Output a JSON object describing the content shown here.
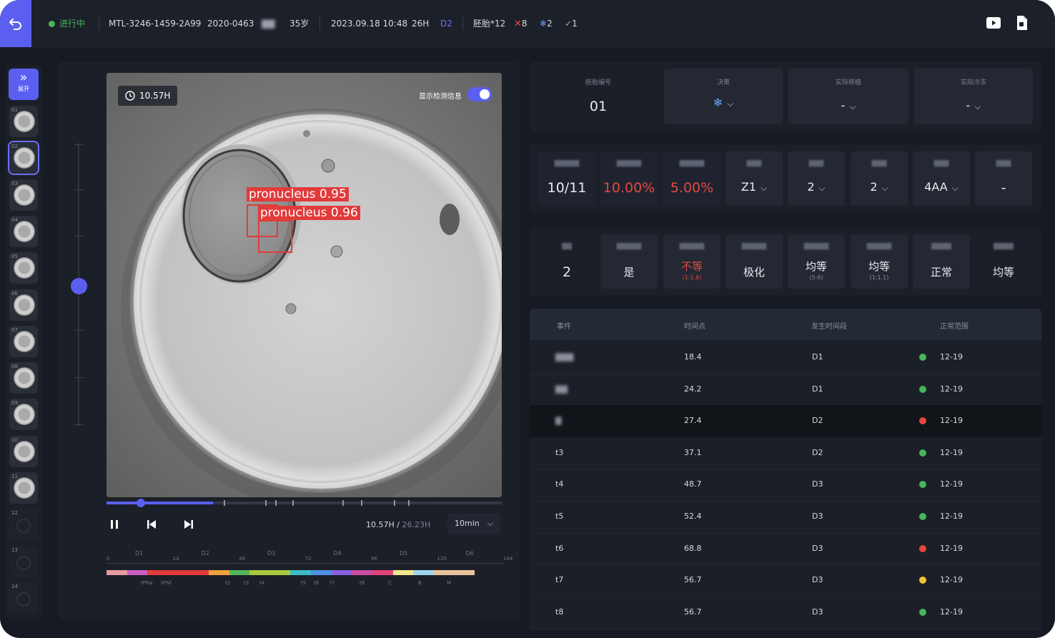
{
  "topbar": {
    "status": "进行中",
    "patient_id": "MTL-3246-1459-2A99",
    "case_no": "2020-0463",
    "patient_name": "▇▇",
    "age": "35岁",
    "datetime": "2023.09.18 10:48",
    "hours": "26H",
    "day": "D2",
    "embryo_count": "胚胎*12",
    "x_count": "8",
    "frozen_count": "2",
    "check_count": "1",
    "colors": {
      "accent": "#5b5ff0",
      "status_green": "#45b757",
      "x_red": "#e14a3f",
      "frozen_blue": "#6aa7ff"
    }
  },
  "sidebar": {
    "expand_label": "展开",
    "thumbs": [
      {
        "num": "01",
        "state": "filled"
      },
      {
        "num": "02",
        "state": "active"
      },
      {
        "num": "03",
        "state": "filled"
      },
      {
        "num": "04",
        "state": "filled"
      },
      {
        "num": "05",
        "state": "filled"
      },
      {
        "num": "06",
        "state": "filled"
      },
      {
        "num": "07",
        "state": "filled"
      },
      {
        "num": "08",
        "state": "filled"
      },
      {
        "num": "09",
        "state": "filled"
      },
      {
        "num": "10",
        "state": "filled"
      },
      {
        "num": "11",
        "state": "filled"
      },
      {
        "num": "12",
        "state": "empty"
      },
      {
        "num": "13",
        "state": "empty"
      },
      {
        "num": "14",
        "state": "empty"
      }
    ]
  },
  "player": {
    "time_badge": "10.57H",
    "toggle_label": "显示检测信息",
    "toggle_on": true,
    "detections": [
      {
        "label": "pronucleus  0.95"
      },
      {
        "label": "pronucleus  0.96"
      }
    ],
    "progress_fraction": 0.27,
    "current_time": "10.57H",
    "total_time": "26.23H",
    "speed": "10min",
    "timeline": {
      "days": [
        "D1",
        "D2",
        "D3",
        "D4",
        "D5",
        "D6"
      ],
      "hours": [
        "0",
        "24",
        "48",
        "72",
        "96",
        "120",
        "144"
      ],
      "events": [
        "tPNa",
        "tPNf",
        "t2",
        "t3",
        "t4",
        "t5",
        "t6",
        "t7",
        "t8",
        "C",
        "B",
        "M"
      ],
      "segment_colors": [
        "#e79aa1",
        "#c75ec2",
        "#e23b3b",
        "#e23b3b",
        "#e23b3b",
        "#f0a33a",
        "#55b65e",
        "#a7c93a",
        "#a7c93a",
        "#3bbdc4",
        "#4e8fe6",
        "#8a5fe0",
        "#c94da0",
        "#e2427b",
        "#f2e68c",
        "#9fd6f2",
        "#e8c39c",
        "#e8c39c"
      ]
    }
  },
  "info_row1": {
    "embryo_label": "胚胎编号",
    "embryo_value": "01",
    "decision_label": "决策",
    "actual_transfer_label": "实际移植",
    "actual_transfer_value": "-",
    "actual_freeze_label": "实际冷冻",
    "actual_freeze_value": "-"
  },
  "info_row2": [
    {
      "caption": "▇▇▇▇▇",
      "value": "10/11",
      "red": false,
      "dropdown": false
    },
    {
      "caption": "▇▇▇▇▇",
      "value": "10.00%",
      "red": true,
      "dropdown": false
    },
    {
      "caption": "▇▇▇▇▇",
      "value": "5.00%",
      "red": true,
      "dropdown": false
    },
    {
      "caption": "▇▇▇",
      "value": "Z1",
      "red": false,
      "dropdown": true
    },
    {
      "caption": "▇▇▇",
      "value": "2",
      "red": false,
      "dropdown": true
    },
    {
      "caption": "▇▇▇",
      "value": "2",
      "red": false,
      "dropdown": true
    },
    {
      "caption": "▇▇▇",
      "value": "4AA",
      "red": false,
      "dropdown": true
    },
    {
      "caption": "▇▇▇",
      "value": "-",
      "red": false,
      "dropdown": false
    }
  ],
  "info_row3": [
    {
      "caption": "▇▇",
      "value": "2",
      "sub": "",
      "red": false
    },
    {
      "caption": "▇▇▇▇▇",
      "value": "是",
      "sub": "",
      "red": false
    },
    {
      "caption": "▇▇▇▇▇",
      "value": "不等",
      "sub": "(1:1.8)",
      "red": true
    },
    {
      "caption": "▇▇▇▇▇",
      "value": "极化",
      "sub": "",
      "red": false
    },
    {
      "caption": "▇▇▇▇▇",
      "value": "均等",
      "sub": "(5:6)",
      "red": false
    },
    {
      "caption": "▇▇▇▇▇",
      "value": "均等",
      "sub": "(1:1.1)",
      "red": false
    },
    {
      "caption": "▇▇▇▇",
      "value": "正常",
      "sub": "",
      "red": false
    },
    {
      "caption": "▇▇▇▇",
      "value": "均等",
      "sub": "",
      "red": false
    }
  ],
  "events_table": {
    "columns": [
      "事件",
      "时间点",
      "发生时间段",
      "正常范围"
    ],
    "rows": [
      {
        "event": "▇▇▇",
        "time": "18.4",
        "period": "D1",
        "status": "green",
        "range": "12-19",
        "blur": true
      },
      {
        "event": "▇▇",
        "time": "24.2",
        "period": "D1",
        "status": "green",
        "range": "12-19",
        "blur": true
      },
      {
        "event": "▇",
        "time": "27.4",
        "period": "D2",
        "status": "red",
        "range": "12-19",
        "blur": true
      },
      {
        "event": "t3",
        "time": "37.1",
        "period": "D2",
        "status": "green",
        "range": "12-19",
        "blur": false
      },
      {
        "event": "t4",
        "time": "48.7",
        "period": "D3",
        "status": "green",
        "range": "12-19",
        "blur": false
      },
      {
        "event": "t5",
        "time": "52.4",
        "period": "D3",
        "status": "green",
        "range": "12-19",
        "blur": false
      },
      {
        "event": "t6",
        "time": "68.8",
        "period": "D3",
        "status": "red",
        "range": "12-19",
        "blur": false
      },
      {
        "event": "t7",
        "time": "56.7",
        "period": "D3",
        "status": "yellow",
        "range": "12-19",
        "blur": false
      },
      {
        "event": "t8",
        "time": "56.7",
        "period": "D3",
        "status": "green",
        "range": "12-19",
        "blur": false
      }
    ],
    "status_colors": {
      "green": "#45b757",
      "red": "#e5483c",
      "yellow": "#f2c230"
    }
  }
}
